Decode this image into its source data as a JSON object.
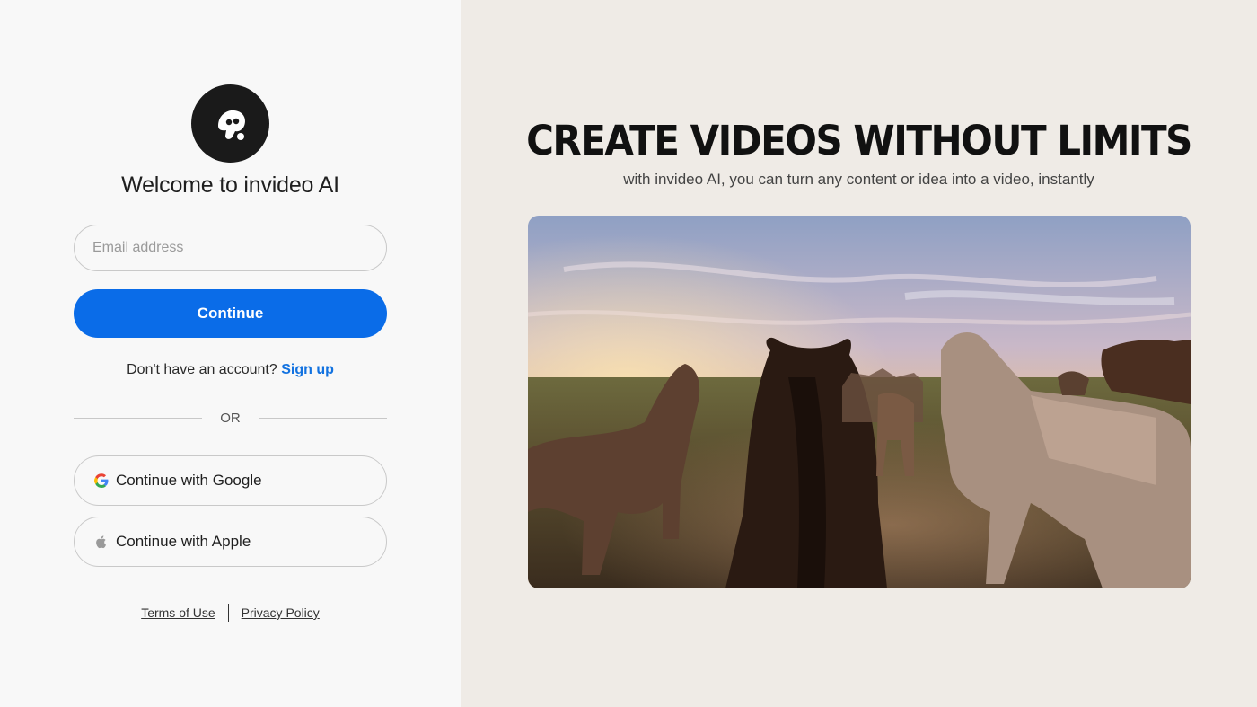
{
  "login": {
    "welcome_title": "Welcome to invideo AI",
    "email_placeholder": "Email address",
    "continue_label": "Continue",
    "no_account_text": "Don't have an account?",
    "signup_label": "Sign up",
    "or_label": "OR",
    "google_label": "Continue with Google",
    "apple_label": "Continue with Apple"
  },
  "footer": {
    "terms_label": "Terms of Use",
    "privacy_label": "Privacy Policy"
  },
  "promo": {
    "headline": "CREATE VIDEOS WITHOUT LIMITS",
    "subheadline": "with invideo AI, you can turn any content or idea into a video, instantly"
  },
  "icons": {
    "logo": "invideo-logo-icon",
    "google": "google-icon",
    "apple": "apple-icon"
  },
  "colors": {
    "accent": "#0a6ce8",
    "link": "#1272e0",
    "left_bg": "#f8f8f8",
    "right_bg": "#efebe6"
  }
}
